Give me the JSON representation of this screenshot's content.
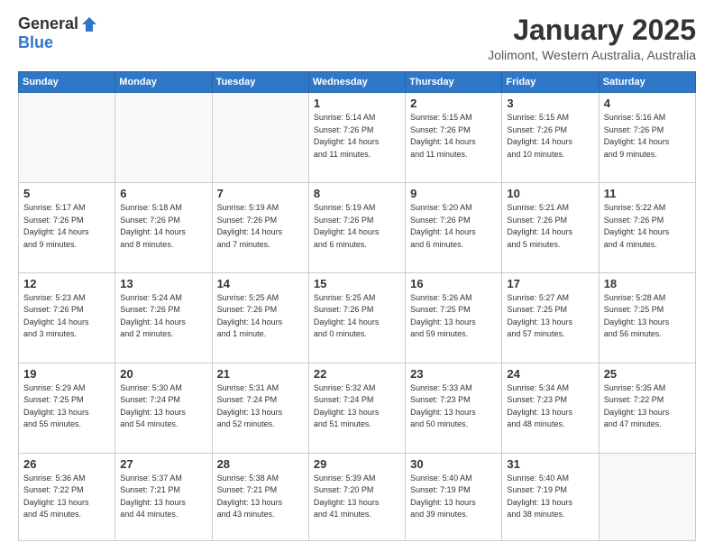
{
  "header": {
    "logo_general": "General",
    "logo_blue": "Blue",
    "month_title": "January 2025",
    "location": "Jolimont, Western Australia, Australia"
  },
  "weekdays": [
    "Sunday",
    "Monday",
    "Tuesday",
    "Wednesday",
    "Thursday",
    "Friday",
    "Saturday"
  ],
  "weeks": [
    [
      {
        "day": "",
        "info": ""
      },
      {
        "day": "",
        "info": ""
      },
      {
        "day": "",
        "info": ""
      },
      {
        "day": "1",
        "info": "Sunrise: 5:14 AM\nSunset: 7:26 PM\nDaylight: 14 hours\nand 11 minutes."
      },
      {
        "day": "2",
        "info": "Sunrise: 5:15 AM\nSunset: 7:26 PM\nDaylight: 14 hours\nand 11 minutes."
      },
      {
        "day": "3",
        "info": "Sunrise: 5:15 AM\nSunset: 7:26 PM\nDaylight: 14 hours\nand 10 minutes."
      },
      {
        "day": "4",
        "info": "Sunrise: 5:16 AM\nSunset: 7:26 PM\nDaylight: 14 hours\nand 9 minutes."
      }
    ],
    [
      {
        "day": "5",
        "info": "Sunrise: 5:17 AM\nSunset: 7:26 PM\nDaylight: 14 hours\nand 9 minutes."
      },
      {
        "day": "6",
        "info": "Sunrise: 5:18 AM\nSunset: 7:26 PM\nDaylight: 14 hours\nand 8 minutes."
      },
      {
        "day": "7",
        "info": "Sunrise: 5:19 AM\nSunset: 7:26 PM\nDaylight: 14 hours\nand 7 minutes."
      },
      {
        "day": "8",
        "info": "Sunrise: 5:19 AM\nSunset: 7:26 PM\nDaylight: 14 hours\nand 6 minutes."
      },
      {
        "day": "9",
        "info": "Sunrise: 5:20 AM\nSunset: 7:26 PM\nDaylight: 14 hours\nand 6 minutes."
      },
      {
        "day": "10",
        "info": "Sunrise: 5:21 AM\nSunset: 7:26 PM\nDaylight: 14 hours\nand 5 minutes."
      },
      {
        "day": "11",
        "info": "Sunrise: 5:22 AM\nSunset: 7:26 PM\nDaylight: 14 hours\nand 4 minutes."
      }
    ],
    [
      {
        "day": "12",
        "info": "Sunrise: 5:23 AM\nSunset: 7:26 PM\nDaylight: 14 hours\nand 3 minutes."
      },
      {
        "day": "13",
        "info": "Sunrise: 5:24 AM\nSunset: 7:26 PM\nDaylight: 14 hours\nand 2 minutes."
      },
      {
        "day": "14",
        "info": "Sunrise: 5:25 AM\nSunset: 7:26 PM\nDaylight: 14 hours\nand 1 minute."
      },
      {
        "day": "15",
        "info": "Sunrise: 5:25 AM\nSunset: 7:26 PM\nDaylight: 14 hours\nand 0 minutes."
      },
      {
        "day": "16",
        "info": "Sunrise: 5:26 AM\nSunset: 7:25 PM\nDaylight: 13 hours\nand 59 minutes."
      },
      {
        "day": "17",
        "info": "Sunrise: 5:27 AM\nSunset: 7:25 PM\nDaylight: 13 hours\nand 57 minutes."
      },
      {
        "day": "18",
        "info": "Sunrise: 5:28 AM\nSunset: 7:25 PM\nDaylight: 13 hours\nand 56 minutes."
      }
    ],
    [
      {
        "day": "19",
        "info": "Sunrise: 5:29 AM\nSunset: 7:25 PM\nDaylight: 13 hours\nand 55 minutes."
      },
      {
        "day": "20",
        "info": "Sunrise: 5:30 AM\nSunset: 7:24 PM\nDaylight: 13 hours\nand 54 minutes."
      },
      {
        "day": "21",
        "info": "Sunrise: 5:31 AM\nSunset: 7:24 PM\nDaylight: 13 hours\nand 52 minutes."
      },
      {
        "day": "22",
        "info": "Sunrise: 5:32 AM\nSunset: 7:24 PM\nDaylight: 13 hours\nand 51 minutes."
      },
      {
        "day": "23",
        "info": "Sunrise: 5:33 AM\nSunset: 7:23 PM\nDaylight: 13 hours\nand 50 minutes."
      },
      {
        "day": "24",
        "info": "Sunrise: 5:34 AM\nSunset: 7:23 PM\nDaylight: 13 hours\nand 48 minutes."
      },
      {
        "day": "25",
        "info": "Sunrise: 5:35 AM\nSunset: 7:22 PM\nDaylight: 13 hours\nand 47 minutes."
      }
    ],
    [
      {
        "day": "26",
        "info": "Sunrise: 5:36 AM\nSunset: 7:22 PM\nDaylight: 13 hours\nand 45 minutes."
      },
      {
        "day": "27",
        "info": "Sunrise: 5:37 AM\nSunset: 7:21 PM\nDaylight: 13 hours\nand 44 minutes."
      },
      {
        "day": "28",
        "info": "Sunrise: 5:38 AM\nSunset: 7:21 PM\nDaylight: 13 hours\nand 43 minutes."
      },
      {
        "day": "29",
        "info": "Sunrise: 5:39 AM\nSunset: 7:20 PM\nDaylight: 13 hours\nand 41 minutes."
      },
      {
        "day": "30",
        "info": "Sunrise: 5:40 AM\nSunset: 7:19 PM\nDaylight: 13 hours\nand 39 minutes."
      },
      {
        "day": "31",
        "info": "Sunrise: 5:40 AM\nSunset: 7:19 PM\nDaylight: 13 hours\nand 38 minutes."
      },
      {
        "day": "",
        "info": ""
      }
    ]
  ]
}
